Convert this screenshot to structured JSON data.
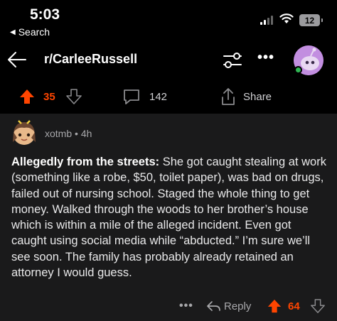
{
  "status_bar": {
    "time": "5:03",
    "back_label": "Search",
    "battery": "12"
  },
  "nav": {
    "title": "r/CarleeRussell"
  },
  "post_actions": {
    "score": "35",
    "comment_count": "142",
    "share_label": "Share"
  },
  "comment": {
    "username": "xotmb",
    "age": "4h",
    "separator": "•",
    "bold_prefix": "Allegedly from the streets:",
    "body": " She got caught stealing at work (something like a robe, $50, toilet paper), was bad on drugs, failed out of nursing school. Staged the whole thing to get money. Walked through the woods to her brother’s house which is within a mile of the alleged incident. Even got caught using social media while “abducted.” I’m sure we’ll see soon. The family has probably already retained an attorney I would guess.",
    "reply_label": "Reply",
    "score": "64"
  },
  "colors": {
    "upvote_active": "#ff4500",
    "background": "#000000",
    "card": "#1a1a1b"
  },
  "icons": [
    "back-triangle-icon",
    "signal-icon",
    "wifi-icon",
    "battery-icon",
    "back-arrow-icon",
    "filter-icon",
    "more-icon",
    "avatar",
    "upvote-icon",
    "downvote-icon",
    "comment-icon",
    "share-icon",
    "reply-icon"
  ]
}
